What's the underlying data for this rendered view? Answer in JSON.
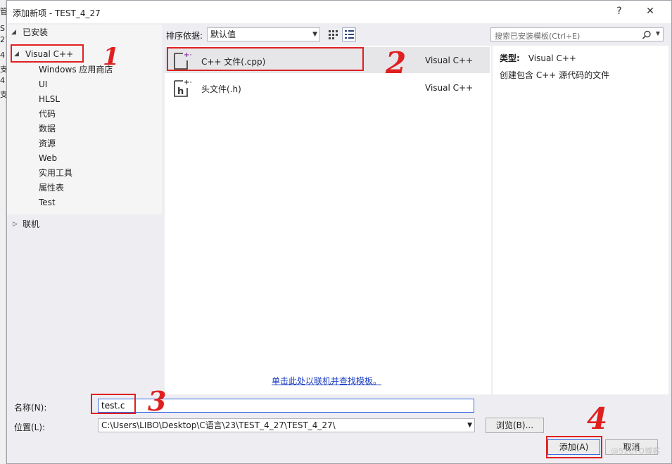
{
  "background_window": {
    "strip_glyphs": [
      "管",
      "S",
      "27",
      "4",
      "支",
      "4",
      "支"
    ]
  },
  "window": {
    "title": "添加新项 - TEST_4_27",
    "help": "?",
    "close": "✕"
  },
  "tree": {
    "installed_label": "已安装",
    "selected": "Visual C++",
    "children": [
      "Windows 应用商店",
      "UI",
      "HLSL",
      "代码",
      "数据",
      "资源",
      "Web",
      "实用工具",
      "属性表",
      "Test"
    ],
    "online_label": "联机"
  },
  "sort": {
    "label": "排序依据:",
    "value": "默认值"
  },
  "search": {
    "placeholder": "搜索已安装模板(Ctrl+E)"
  },
  "templates": [
    {
      "name": "C++ 文件(.cpp)",
      "lang": "Visual C++",
      "icon": "cpp-file-icon"
    },
    {
      "name": "头文件(.h)",
      "lang": "Visual C++",
      "icon": "header-file-icon"
    }
  ],
  "online_link": "单击此处以联机并查找模板。",
  "details": {
    "type_label": "类型:",
    "type_value": "Visual C++",
    "description": "创建包含 C++ 源代码的文件"
  },
  "form": {
    "name_label": "名称(N):",
    "name_value": "test.c",
    "location_label": "位置(L):",
    "location_value": "C:\\Users\\LIBO\\Desktop\\C语言\\23\\TEST_4_27\\TEST_4_27\\",
    "browse_button": "浏览(B)...",
    "add_button": "添加(A)",
    "cancel_button": "取消"
  },
  "annotations": [
    "1",
    "2",
    "3",
    "4"
  ],
  "watermark": "@51CTO博客",
  "colors": {
    "accent_border": "#3d6be0",
    "annotation_red": "#e02020",
    "link_blue": "#1a3dc1",
    "selected_row": "#e6e6e9"
  }
}
